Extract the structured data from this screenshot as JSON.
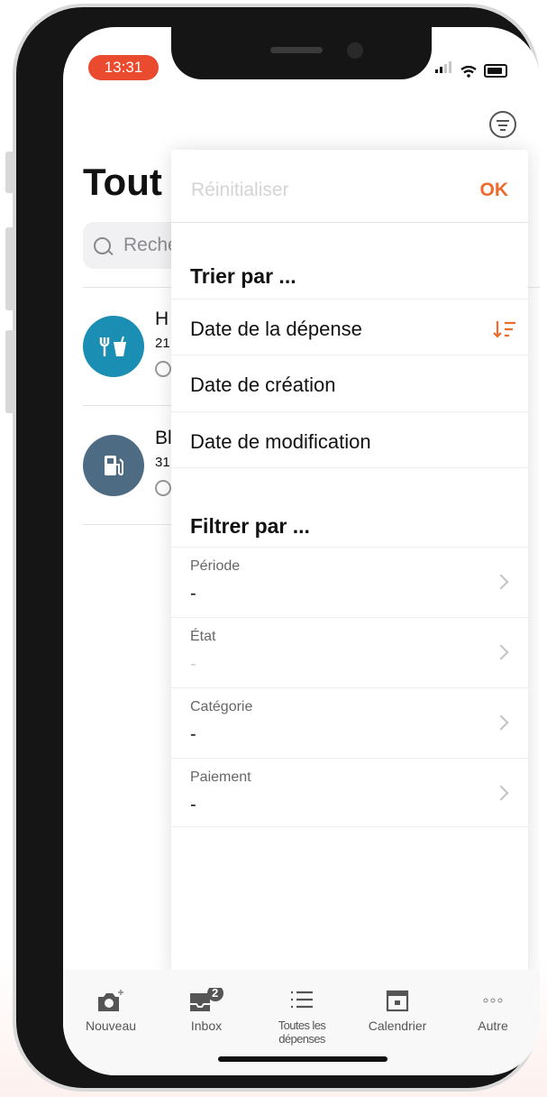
{
  "status": {
    "time": "13:31"
  },
  "page": {
    "title": "Tout"
  },
  "search": {
    "placeholder": "Reche"
  },
  "expenses": [
    {
      "title": "H",
      "sub": "21",
      "color": "#1a8fb3",
      "icon": "restaurant-icon"
    },
    {
      "title": "Bl",
      "sub": "31",
      "color": "#4e6b84",
      "icon": "fuel-icon"
    }
  ],
  "overlay": {
    "reset_label": "Réinitialiser",
    "ok_label": "OK",
    "sort_title": "Trier par ...",
    "sort_options": [
      {
        "label": "Date de la dépense",
        "selected": true
      },
      {
        "label": "Date de création",
        "selected": false
      },
      {
        "label": "Date de modification",
        "selected": false
      }
    ],
    "filter_title": "Filtrer par ...",
    "filters": [
      {
        "label": "Période",
        "value": "-"
      },
      {
        "label": "État",
        "value": "-"
      },
      {
        "label": "Catégorie",
        "value": "-"
      },
      {
        "label": "Paiement",
        "value": "-"
      }
    ]
  },
  "tabbar": {
    "items": [
      {
        "label": "Nouveau",
        "icon": "camera-plus-icon"
      },
      {
        "label": "Inbox",
        "icon": "inbox-icon",
        "badge": "2"
      },
      {
        "label": "Toutes les dépenses",
        "icon": "list-icon"
      },
      {
        "label": "Calendrier",
        "icon": "calendar-icon"
      },
      {
        "label": "Autre",
        "icon": "more-icon"
      }
    ]
  },
  "colors": {
    "accent": "#ef6a2d",
    "status_pill": "#ea4a2e"
  }
}
